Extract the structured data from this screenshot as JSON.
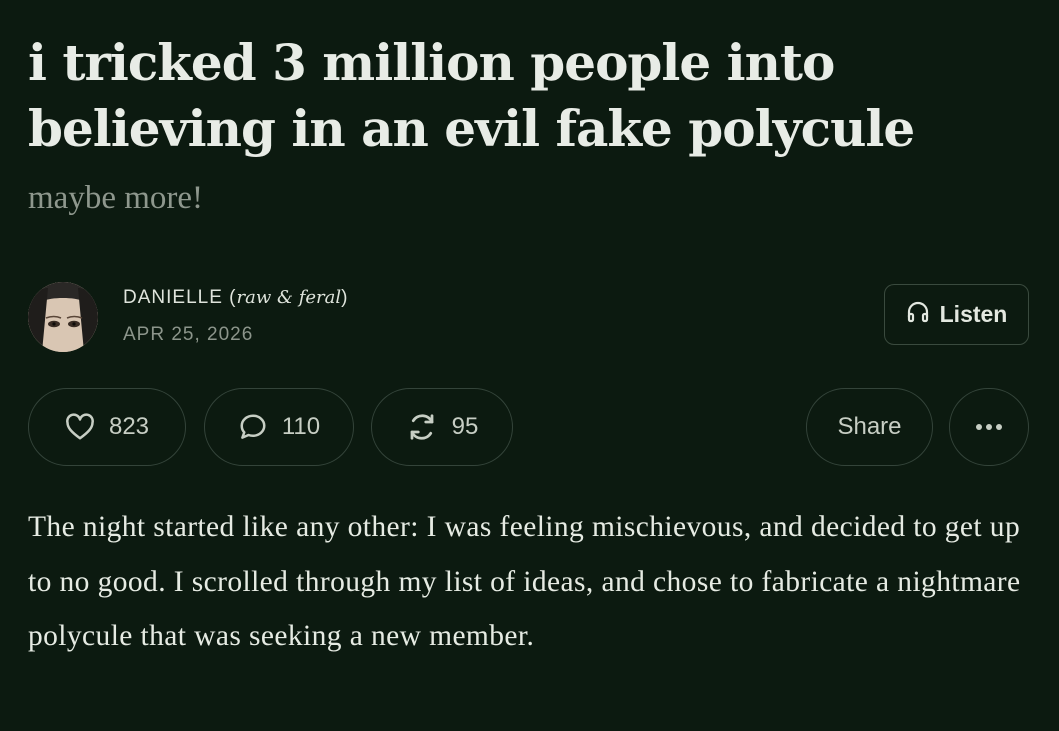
{
  "post": {
    "title": "i tricked 3 million people into believing in an evil fake polycule",
    "subtitle": "maybe more!"
  },
  "author": {
    "name": "DANIELLE",
    "paren_open": " (",
    "tag": "raw & feral",
    "paren_close": ")",
    "date": "APR 25, 2026"
  },
  "listen": {
    "label": "Listen"
  },
  "actions": {
    "likes": "823",
    "comments": "110",
    "restacks": "95",
    "share_label": "Share"
  },
  "article": {
    "paragraph": "The night started like any other: I was feeling mischievous, and decided to get up to no good. I scrolled through my list of ideas, and chose to fabricate a nightmare polycule that was seeking a new member."
  },
  "colors": {
    "background": "#0c1a10",
    "text": "#e6ebe3",
    "muted": "#8c958b",
    "border": "#34443a"
  },
  "icons": {
    "listen": "headphones-icon",
    "like": "heart-icon",
    "comment": "speech-bubble-icon",
    "restack": "restack-arrows-icon",
    "more": "more-dots-icon"
  }
}
